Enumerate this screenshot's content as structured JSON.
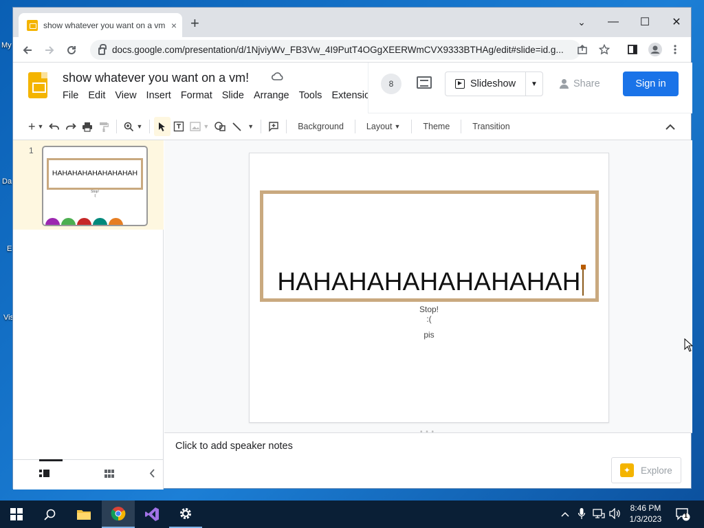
{
  "desktop": {
    "icons": [
      {
        "label": "My"
      },
      {
        "label": "Da"
      },
      {
        "label": "E"
      },
      {
        "label": "Vis"
      }
    ]
  },
  "browser": {
    "tab_title": "show whatever you want on a vm!",
    "tab_close": "×",
    "new_tab": "+",
    "url": "docs.google.com/presentation/d/1NjviyWv_FB3Vw_4I9PutT4OGgXEERWmCVX9333BTHAg/edit#slide=id.g...",
    "controls": {
      "minimize": "—",
      "maximize": "☐",
      "close": "✕",
      "tab_search": "⌄"
    }
  },
  "slides": {
    "doc_title": "show whatever you want on a vm!",
    "menu": [
      "File",
      "Edit",
      "View",
      "Insert",
      "Format",
      "Slide",
      "Arrange",
      "Tools",
      "Extensio"
    ],
    "viewer_count": "8",
    "slideshow_label": "Slideshow",
    "share_label": "Share",
    "signin_label": "Sign in",
    "toolbar": {
      "background": "Background",
      "layout": "Layout",
      "theme": "Theme",
      "transition": "Transition"
    },
    "filmstrip": {
      "slide_number": "1",
      "thumb_text": "HAHAHAHAHAHAHAHAH",
      "thumb_sub1": "Stop!",
      "thumb_sub2": ":(",
      "circle_colors": [
        "#9c27b0",
        "#4caf50",
        "#c62828",
        "#00897b",
        "#e67e22"
      ]
    },
    "slide": {
      "big_text": "HAHAHAHAHAHAHAHAH",
      "line1": "Stop!",
      "line2": ":(",
      "line3": "pis"
    },
    "notes_placeholder": "Click to add speaker notes",
    "explore_label": "Explore",
    "colors": {
      "accent": "#1a73e8",
      "frame": "#c9a97f",
      "brand": "#f4b400"
    }
  },
  "taskbar": {
    "time": "8:46 PM",
    "date": "1/3/2023",
    "notification_count": "1"
  }
}
